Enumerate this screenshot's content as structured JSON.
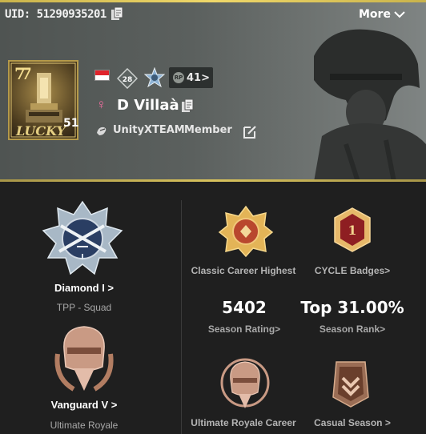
{
  "header": {
    "uid": "UID: 51290935201",
    "more_label": "More",
    "avatar_level": "51",
    "level_badge": "28",
    "rp_value": "41>",
    "rp_icon_text": "RP",
    "player_name": "D Villaà",
    "gender_symbol": "♀",
    "clan_name": "UnityXTEAM",
    "clan_role": "Member",
    "flag_colors": [
      "#e0242c",
      "#ffffff"
    ]
  },
  "tpp": {
    "tier": "Diamond I >",
    "mode": "TPP - Squad"
  },
  "ultimate": {
    "tier": "Vanguard V >",
    "mode": "Ultimate Royale"
  },
  "career": {
    "classic_highest_label": "Classic Career Highest",
    "cycle_badges_label": "CYCLE Badges>",
    "season_rating_value": "5402",
    "season_rating_label": "Season Rating>",
    "season_rank_value": "Top 31.00%",
    "season_rank_label": "Season Rank>",
    "ultimate_career_label": "Ultimate Royale Career",
    "casual_season_label": "Casual Season >"
  },
  "icons": {
    "copy": "copy-icon",
    "edit": "edit-icon",
    "chevron": "chevron-down-icon",
    "clan": "clan-emblem-icon"
  }
}
